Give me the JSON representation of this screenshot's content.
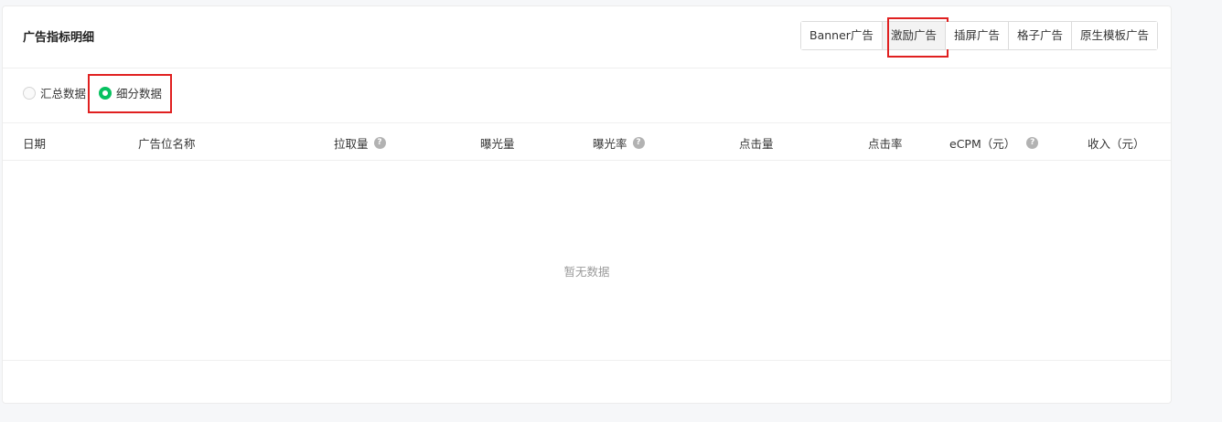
{
  "panel": {
    "title": "广告指标明细"
  },
  "ad_tabs": [
    {
      "label": "Banner广告",
      "active": false
    },
    {
      "label": "激励广告",
      "active": true
    },
    {
      "label": "插屏广告",
      "active": false
    },
    {
      "label": "格子广告",
      "active": false
    },
    {
      "label": "原生模板广告",
      "active": false
    }
  ],
  "data_mode": {
    "options": [
      {
        "label": "汇总数据",
        "checked": false
      },
      {
        "label": "细分数据",
        "checked": true
      }
    ]
  },
  "table": {
    "columns": [
      {
        "label": "日期",
        "help": false
      },
      {
        "label": "广告位名称",
        "help": false
      },
      {
        "label": "拉取量",
        "help": true
      },
      {
        "label": "曝光量",
        "help": false
      },
      {
        "label": "曝光率",
        "help": true
      },
      {
        "label": "点击量",
        "help": false
      },
      {
        "label": "点击率",
        "help": false
      },
      {
        "label": "eCPM（元）",
        "help": true
      },
      {
        "label": "收入（元）",
        "help": false
      }
    ],
    "rows": [],
    "empty_text": "暂无数据"
  },
  "icons": {
    "help": "question-circle-icon"
  },
  "colors": {
    "accent_green": "#07c160",
    "highlight_red": "#e02020"
  }
}
